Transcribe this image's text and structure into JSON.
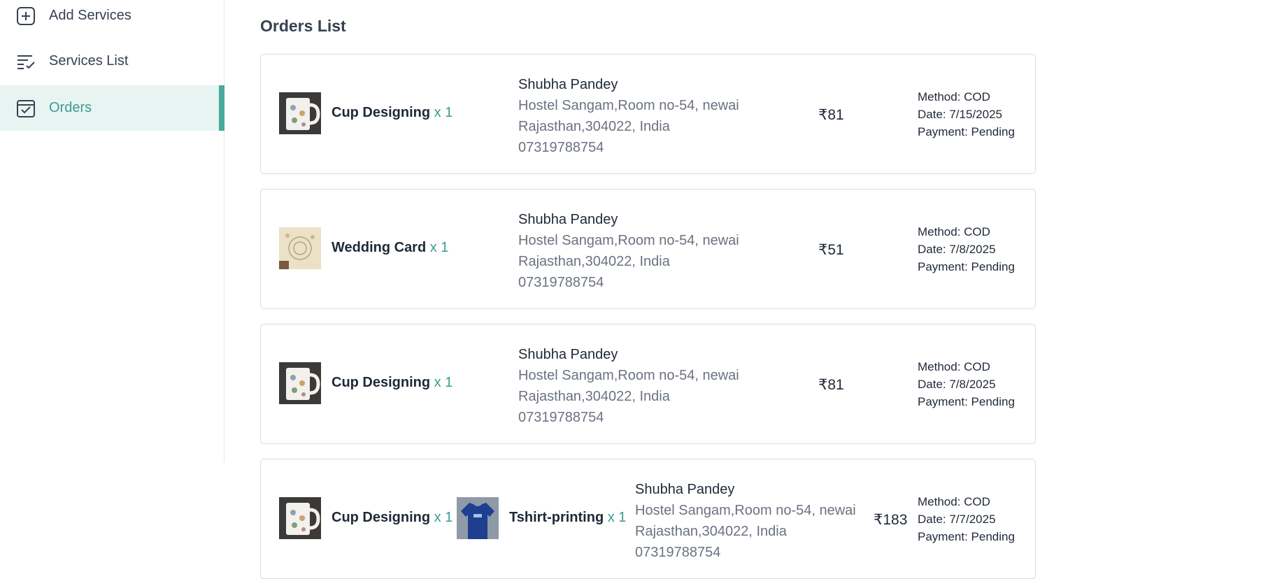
{
  "sidebar": {
    "items": [
      {
        "label": "Add Services",
        "icon": "add-square-icon"
      },
      {
        "label": "Services List",
        "icon": "list-check-icon"
      },
      {
        "label": "Orders",
        "icon": "calendar-check-icon",
        "active": true
      }
    ],
    "active_color": "#3a9d91"
  },
  "main": {
    "title": "Orders List",
    "orders": [
      {
        "items": [
          {
            "name": "Cup Designing",
            "qty": "x 1",
            "image": "mug-image"
          }
        ],
        "customer": "Shubha Pandey",
        "address_line1": "Hostel Sangam,Room no-54, newai",
        "address_line2": "Rajasthan,304022, India",
        "phone": "07319788754",
        "amount": "₹81",
        "method": "Method: COD",
        "date": "Date: 7/15/2025",
        "payment": "Payment: Pending"
      },
      {
        "items": [
          {
            "name": "Wedding Card",
            "qty": "x 1",
            "image": "wedding-card-image"
          }
        ],
        "customer": "Shubha Pandey",
        "address_line1": "Hostel Sangam,Room no-54, newai",
        "address_line2": "Rajasthan,304022, India",
        "phone": "07319788754",
        "amount": "₹51",
        "method": "Method: COD",
        "date": "Date: 7/8/2025",
        "payment": "Payment: Pending"
      },
      {
        "items": [
          {
            "name": "Cup Designing",
            "qty": "x 1",
            "image": "mug-image"
          }
        ],
        "customer": "Shubha Pandey",
        "address_line1": "Hostel Sangam,Room no-54, newai",
        "address_line2": "Rajasthan,304022, India",
        "phone": "07319788754",
        "amount": "₹81",
        "method": "Method: COD",
        "date": "Date: 7/8/2025",
        "payment": "Payment: Pending"
      },
      {
        "items": [
          {
            "name": "Cup Designing",
            "qty": "x 1",
            "image": "mug-image"
          },
          {
            "name": "Tshirt-printing",
            "qty": "x 1",
            "image": "tshirt-image"
          }
        ],
        "customer": "Shubha Pandey",
        "address_line1": "Hostel Sangam,Room no-54, newai",
        "address_line2": "Rajasthan,304022, India",
        "phone": "07319788754",
        "amount": "₹183",
        "method": "Method: COD",
        "date": "Date: 7/7/2025",
        "payment": "Payment: Pending"
      }
    ]
  }
}
